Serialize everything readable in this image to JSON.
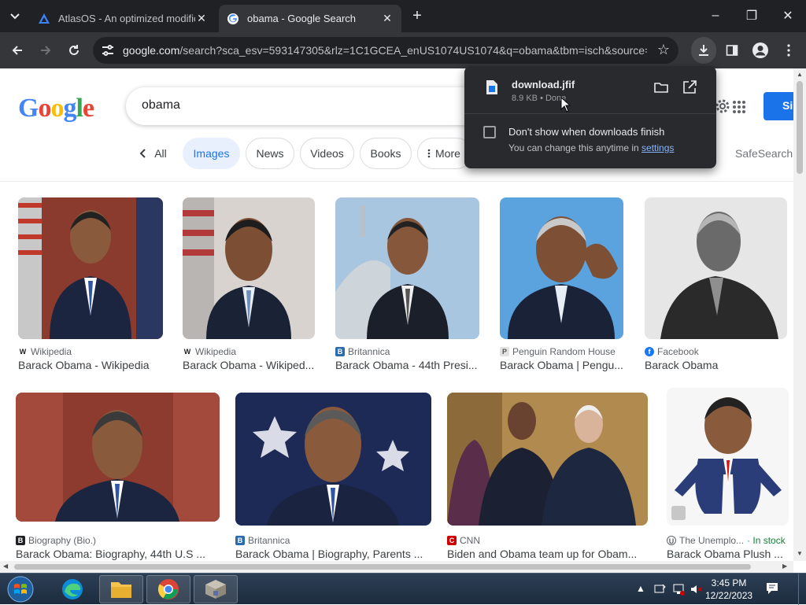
{
  "browser": {
    "tabs": [
      {
        "title": "AtlasOS - An optimized modific",
        "active": false
      },
      {
        "title": "obama - Google Search",
        "active": true
      }
    ],
    "new_tab": "+",
    "window_controls": {
      "minimize": "–",
      "maximize": "❐",
      "close": "✕"
    },
    "url_host": "google.com",
    "url_rest": "/search?sca_esv=593147305&rlz=1C1GCEA_enUS1074US1074&q=obama&tbm=isch&source=..."
  },
  "downloads": {
    "file_name": "download.jfif",
    "file_meta": "8.9 KB • Done",
    "checkbox_label": "Don't show when downloads finish",
    "hint_prefix": "You can change this anytime in ",
    "hint_link": "settings"
  },
  "search": {
    "logo_letters": [
      "G",
      "o",
      "o",
      "g",
      "l",
      "e"
    ],
    "query": "obama",
    "signin_label": "Si",
    "filters": {
      "all": "All",
      "images": "Images",
      "news": "News",
      "videos": "Videos",
      "books": "Books",
      "more": "More"
    },
    "safesearch": "SafeSearch"
  },
  "results": {
    "row1": [
      {
        "source": "Wikipedia",
        "source_icon": "W",
        "caption": "Barack Obama - Wikipedia"
      },
      {
        "source": "Wikipedia",
        "source_icon": "W",
        "caption": "Barack Obama - Wikiped..."
      },
      {
        "source": "Britannica",
        "source_icon": "B",
        "caption": "Barack Obama - 44th Presi..."
      },
      {
        "source": "Penguin Random House",
        "source_icon": "P",
        "caption": "Barack Obama | Pengu..."
      },
      {
        "source": "Facebook",
        "source_icon": "f",
        "caption": "Barack Obama"
      }
    ],
    "row2": [
      {
        "source": "Biography (Bio.)",
        "source_icon": "B",
        "caption": "Barack Obama: Biography, 44th U.S ..."
      },
      {
        "source": "Britannica",
        "source_icon": "B",
        "caption": "Barack Obama | Biography, Parents ..."
      },
      {
        "source": "CNN",
        "source_icon": "C",
        "caption": "Biden and Obama team up for Obam..."
      },
      {
        "source": "The Unemplo...",
        "source_icon": "U",
        "caption": "Barack Obama Plush ...",
        "badge": "· In stock"
      }
    ]
  },
  "taskbar": {
    "time": "3:45 PM",
    "date": "12/22/2023"
  },
  "colors": {
    "google_blue": "#1a73e8",
    "chrome_dark": "#202124",
    "chrome_toolbar": "#35363a",
    "download_panel": "#292a2d"
  }
}
